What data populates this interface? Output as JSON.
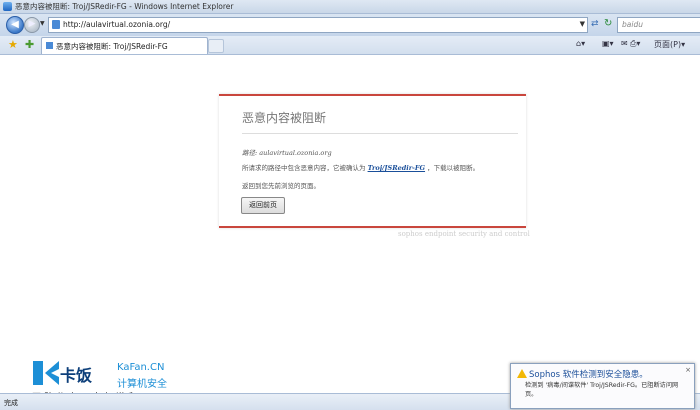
{
  "window": {
    "title": "恶意内容被阻断: Troj/JSRedir-FG - Windows Internet Explorer"
  },
  "navbar": {
    "address": "http://aulavirtual.ozonia.org/",
    "search_placeholder": "baidu"
  },
  "tabbar": {
    "tab_label": "恶意内容被阻断: Troj/JSRedir-FG",
    "page_menu": "页面(P)"
  },
  "block_page": {
    "title": "恶意内容被阻断",
    "path_label": "路径:",
    "path_value": "aulavirtual.ozonia.org",
    "message_before": "所请求的路径中包含恶意内容，它被确认为",
    "threat_name": "Troj/JSRedir-FG",
    "message_after": "，下载以被阻断。",
    "return_text": "返回到您先前浏览的页面。",
    "home_button": "返回前页",
    "footer": "sophos endpoint security and control"
  },
  "watermark": {
    "brand_mark": "卡饭",
    "brand_en": "KaFan.CN",
    "brand_cn": "计算机安全",
    "slogan": "互助分享　大气谦和"
  },
  "statusbar": {
    "text": "完成"
  },
  "notification": {
    "title": "Sophos 软件检测到安全隐患。",
    "body": "检测到 '病毒/间谍软件' Troj/JSRedir-FG。已阻断访问网页。",
    "close": "×"
  }
}
